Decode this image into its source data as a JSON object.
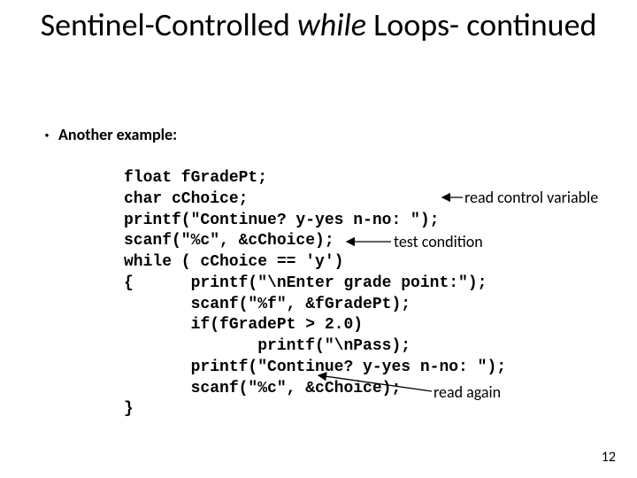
{
  "title_pre": "Sentinel-Controlled ",
  "title_italic": "while",
  "title_post": " Loops- continued",
  "bullet": "Another example:",
  "code": {
    "l1": "float fGradePt;",
    "l2": "char cChoice;",
    "l3": "printf(\"Continue? y-yes n-no: \");",
    "l4": "scanf(\"%c\", &cChoice);",
    "l5": "while ( cChoice == 'y')",
    "l6": "{      printf(\"\\nEnter grade point:\");",
    "l7": "       scanf(\"%f\", &fGradePt);",
    "l8": "       if(fGradePt > 2.0)",
    "l9": "              printf(\"\\nPass);",
    "l10": "       printf(\"Continue? y-yes n-no: \");",
    "l11": "       scanf(\"%c\", &cChoice);",
    "l12": "}"
  },
  "annot": {
    "read_ctrl": "read control variable",
    "test_cond": "test condition",
    "read_again": "read again"
  },
  "page": "12"
}
